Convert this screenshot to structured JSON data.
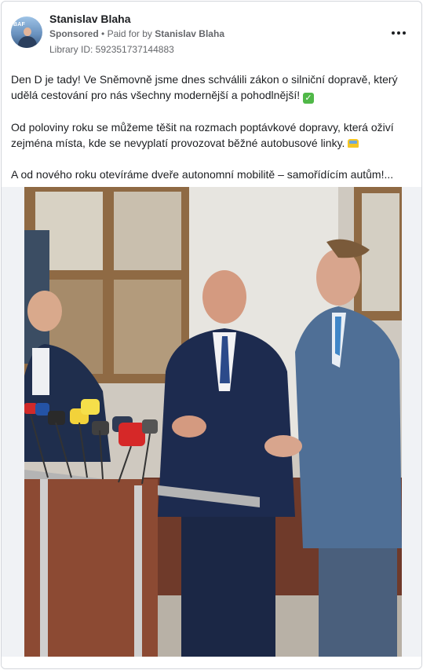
{
  "post": {
    "author_name": "Stanislav Blaha",
    "sponsored_label": "Sponsored",
    "paid_for_by_label": "Paid for by",
    "paid_for_by_name": "Stanislav Blaha",
    "library_id": "Library ID: 592351737144883",
    "more_icon": "more-horizontal-icon",
    "paragraphs": [
      "Den D je tady! Ve Sněmovně jsme dnes schválili zákon o silniční dopravě, který udělá cestování pro nás všechny modernější a pohodlnější!",
      "Od poloviny roku se můžeme těšit na rozmach poptávkové dopravy, která oživí zejména místa, kde se nevyplatí provozovat běžné autobusové linky.",
      "A od nového roku otevíráme dveře autonomní mobilitě – samořídícím autům!..."
    ],
    "emoji_1": "check-mark-emoji",
    "emoji_2": "bus-emoji",
    "image": "press-conference-photo",
    "avatar_badge_text": "BAF"
  },
  "colors": {
    "text_primary": "#1c1e21",
    "text_secondary": "#65676b",
    "media_background": "#f0f2f5",
    "border": "#d3d6db"
  }
}
